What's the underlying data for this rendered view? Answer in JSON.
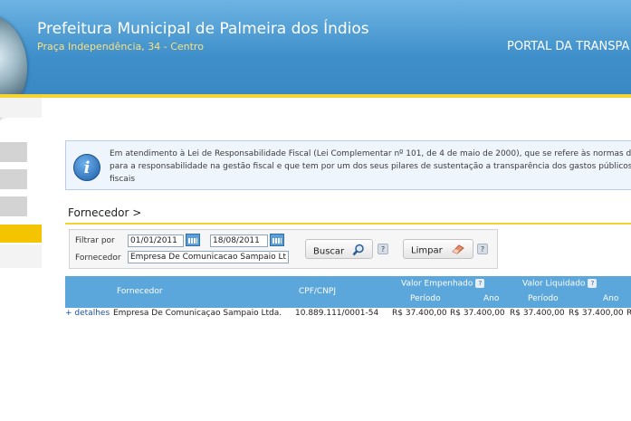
{
  "header": {
    "title": "Prefeitura Municipal de Palmeira dos Índios",
    "address": "Praça Independência, 34 - Centro",
    "portal": "PORTAL DA TRANSPA"
  },
  "info": {
    "icon": "info-icon",
    "line1": "Em atendimento à Lei de Responsabilidade Fiscal (Lei Complementar nº 101, de 4 de maio de 2000), que se refere às normas de",
    "line2": "para a responsabilidade na gestão fiscal e que tem por um dos seus pilares de sustentação a transparência dos gastos públicos e",
    "line3": "fiscais"
  },
  "section": {
    "title": "Fornecedor >"
  },
  "filter": {
    "filter_label": "Filtrar por",
    "date_from": "01/01/2011",
    "date_to": "18/08/2011",
    "supplier_label": "Fornecedor",
    "supplier_value": "Empresa De Comunicacao Sampaio Ltd",
    "search_button": "Buscar",
    "clear_button": "Limpar",
    "help": "?"
  },
  "table": {
    "headers": {
      "fornecedor": "Fornecedor",
      "cpf": "CPF/CNPJ",
      "empenhado": "Valor Empenhado",
      "liquidado": "Valor Liquidado",
      "periodo": "Período",
      "ano": "Ano",
      "help": "?"
    },
    "rows": [
      {
        "details": "+ detalhes",
        "supplier": "Empresa De Comunicaçao Sampaio Ltda.",
        "cnpj": "10.889.111/0001-54",
        "emp_periodo": "R$ 37.400,00",
        "emp_ano": "R$ 37.400,00",
        "liq_periodo": "R$ 37.400,00",
        "liq_ano": "R$ 37.400,00",
        "extra": "R"
      }
    ]
  },
  "colors": {
    "header_blue": "#3f8fcb",
    "accent_yellow": "#f3d431",
    "table_header": "#5ba6da",
    "link": "#1b53a3"
  }
}
